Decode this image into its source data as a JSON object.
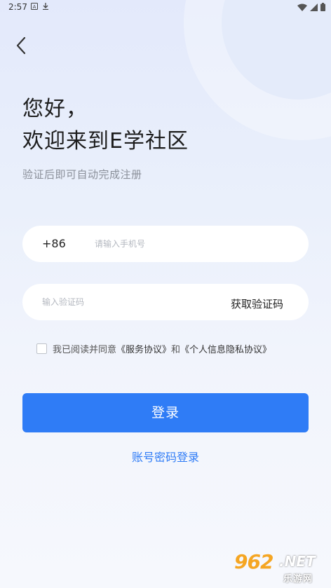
{
  "status_bar": {
    "time": "2:57"
  },
  "header": {
    "greeting_line1": "您好，",
    "greeting_line2": "欢迎来到E学社区",
    "subtitle": "验证后即可自动完成注册"
  },
  "form": {
    "country_code": "+86",
    "phone_placeholder": "请输入手机号",
    "phone_value": "",
    "code_placeholder": "输入验证码",
    "code_value": "",
    "get_code_label": "获取验证码"
  },
  "agreement": {
    "checked": false,
    "prefix": "我已阅读并同意",
    "service_link": "《服务协议》",
    "and": "和",
    "privacy_link": "《个人信息隐私协议》"
  },
  "actions": {
    "login_label": "登录",
    "password_login_label": "账号密码登录"
  },
  "watermark": {
    "brand": "962",
    "net": ".NET",
    "sub": "乐游网"
  },
  "colors": {
    "accent": "#2f7cf6",
    "background": "#e8eefb"
  }
}
